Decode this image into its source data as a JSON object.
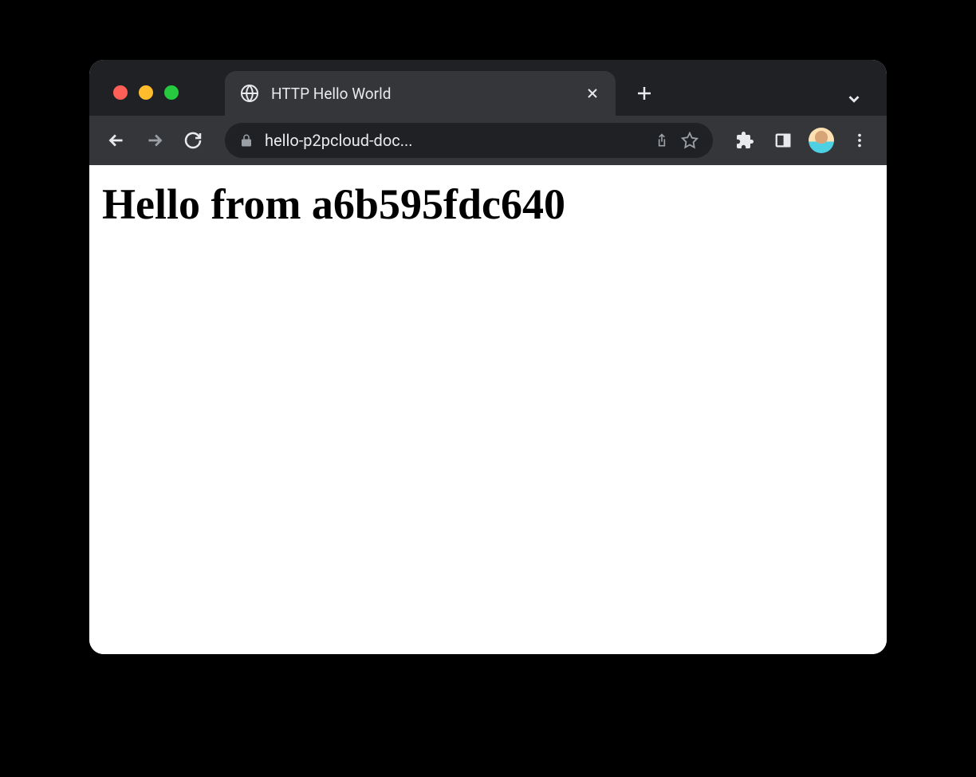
{
  "tab": {
    "title": "HTTP Hello World"
  },
  "address": {
    "url_display": "hello-p2pcloud-doc..."
  },
  "page": {
    "heading": "Hello from a6b595fdc640"
  }
}
